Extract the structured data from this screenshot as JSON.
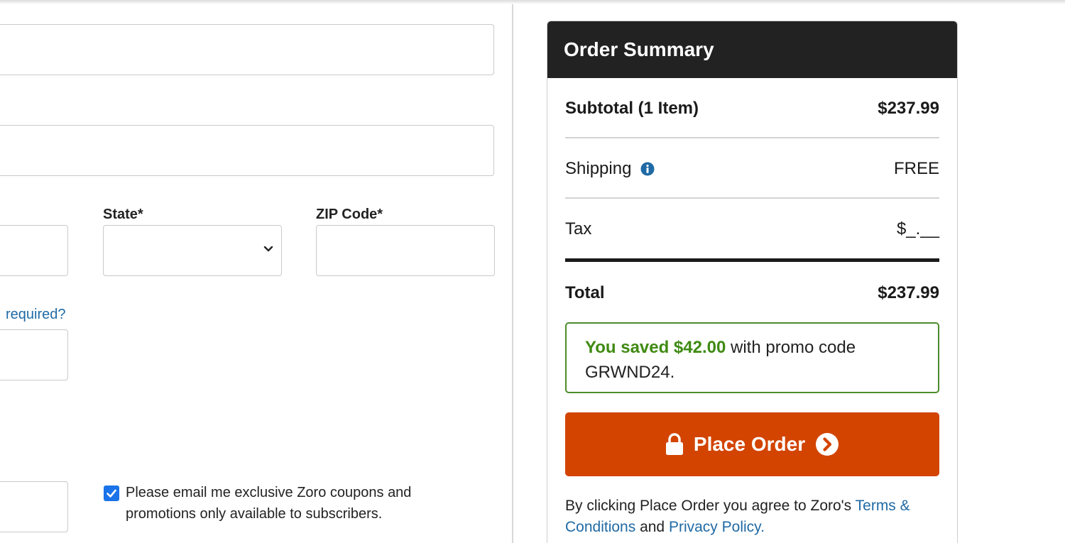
{
  "form": {
    "state_label": "State*",
    "zip_label": "ZIP Code*",
    "required_link": "required?",
    "email_opt_in_text": "Please email me exclusive Zoro coupons and promotions only available to subscribers.",
    "email_opt_in_checked": true
  },
  "summary": {
    "title": "Order Summary",
    "subtotal_label": "Subtotal (1 Item)",
    "subtotal_value": "$237.99",
    "shipping_label": "Shipping",
    "shipping_value": "FREE",
    "tax_label": "Tax",
    "tax_value": "$_.__",
    "total_label": "Total",
    "total_value": "$237.99",
    "promo_saved": "You saved $42.00",
    "promo_text": " with promo code GRWND24.",
    "place_order_label": "Place Order",
    "legal_prefix": "By clicking Place Order you agree to Zoro's ",
    "terms_link": "Terms & Conditions",
    "legal_and": " and ",
    "privacy_link": "Privacy Policy."
  },
  "colors": {
    "header_bg": "#222222",
    "place_order_bg": "#d24400",
    "promo_green": "#3f8a12",
    "link_blue": "#1f6aa5",
    "checkbox_blue": "#1a73e8"
  },
  "icons": {
    "shipping_info": "info-icon",
    "place_order_lock": "lock-icon",
    "place_order_arrow": "chevron-right-circle-icon",
    "state_select": "chevron-down-icon",
    "opt_in": "checkmark-icon"
  }
}
